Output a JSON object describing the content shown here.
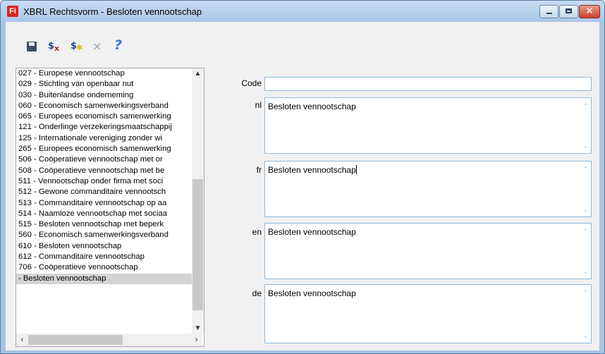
{
  "window": {
    "title": "XBRL Rechtsvorm - Besloten vennootschap",
    "app_icon_text": "Fi"
  },
  "toolbar": {
    "icons": [
      "save-icon",
      "delete-icon",
      "new-icon",
      "cancel-icon",
      "help-icon"
    ]
  },
  "list": {
    "items": [
      "027 - Europese vennootschap",
      "029 - Stichting van openbaar nut",
      "030 - Buitenlandse onderneming",
      "060 - Economisch samenwerkingsverband",
      "065 - Europees economisch samenwerking",
      "121 - Onderlinge verzekeringsmaatschappij",
      "125 - Internationale vereniging zonder wi",
      "265 - Europees economisch samenwerking",
      "506 - Coöperatieve vennootschap met or",
      "508 - Coöperatieve vennootschap met be",
      "511 - Vennootschap onder firma met soci",
      "512 - Gewone commanditaire vennootsch",
      "513 - Commanditaire vennootschap op aa",
      "514 - Naamloze vennootschap met sociaa",
      "515 - Besloten vennootschap met beperk",
      "560 - Economisch samenwerkingsverband",
      "610 - Besloten vennootschap",
      "612 - Commanditaire vennootschap",
      "706 - Coöperatieve vennootschap",
      " - Besloten vennootschap"
    ]
  },
  "form": {
    "code_label": "Code",
    "code_value": "",
    "nl_label": "nl",
    "nl_value": "Besloten vennootschap",
    "fr_label": "fr",
    "fr_value": "Besloten vennootschap",
    "en_label": "en",
    "en_value": "Besloten vennootschap",
    "de_label": "de",
    "de_value": "Besloten vennootschap"
  },
  "colors": {
    "titlebar": "#a9c6e9",
    "close_button": "#c9412d",
    "field_border": "#8fb9d9",
    "selected_row": "#d4d4d4"
  }
}
